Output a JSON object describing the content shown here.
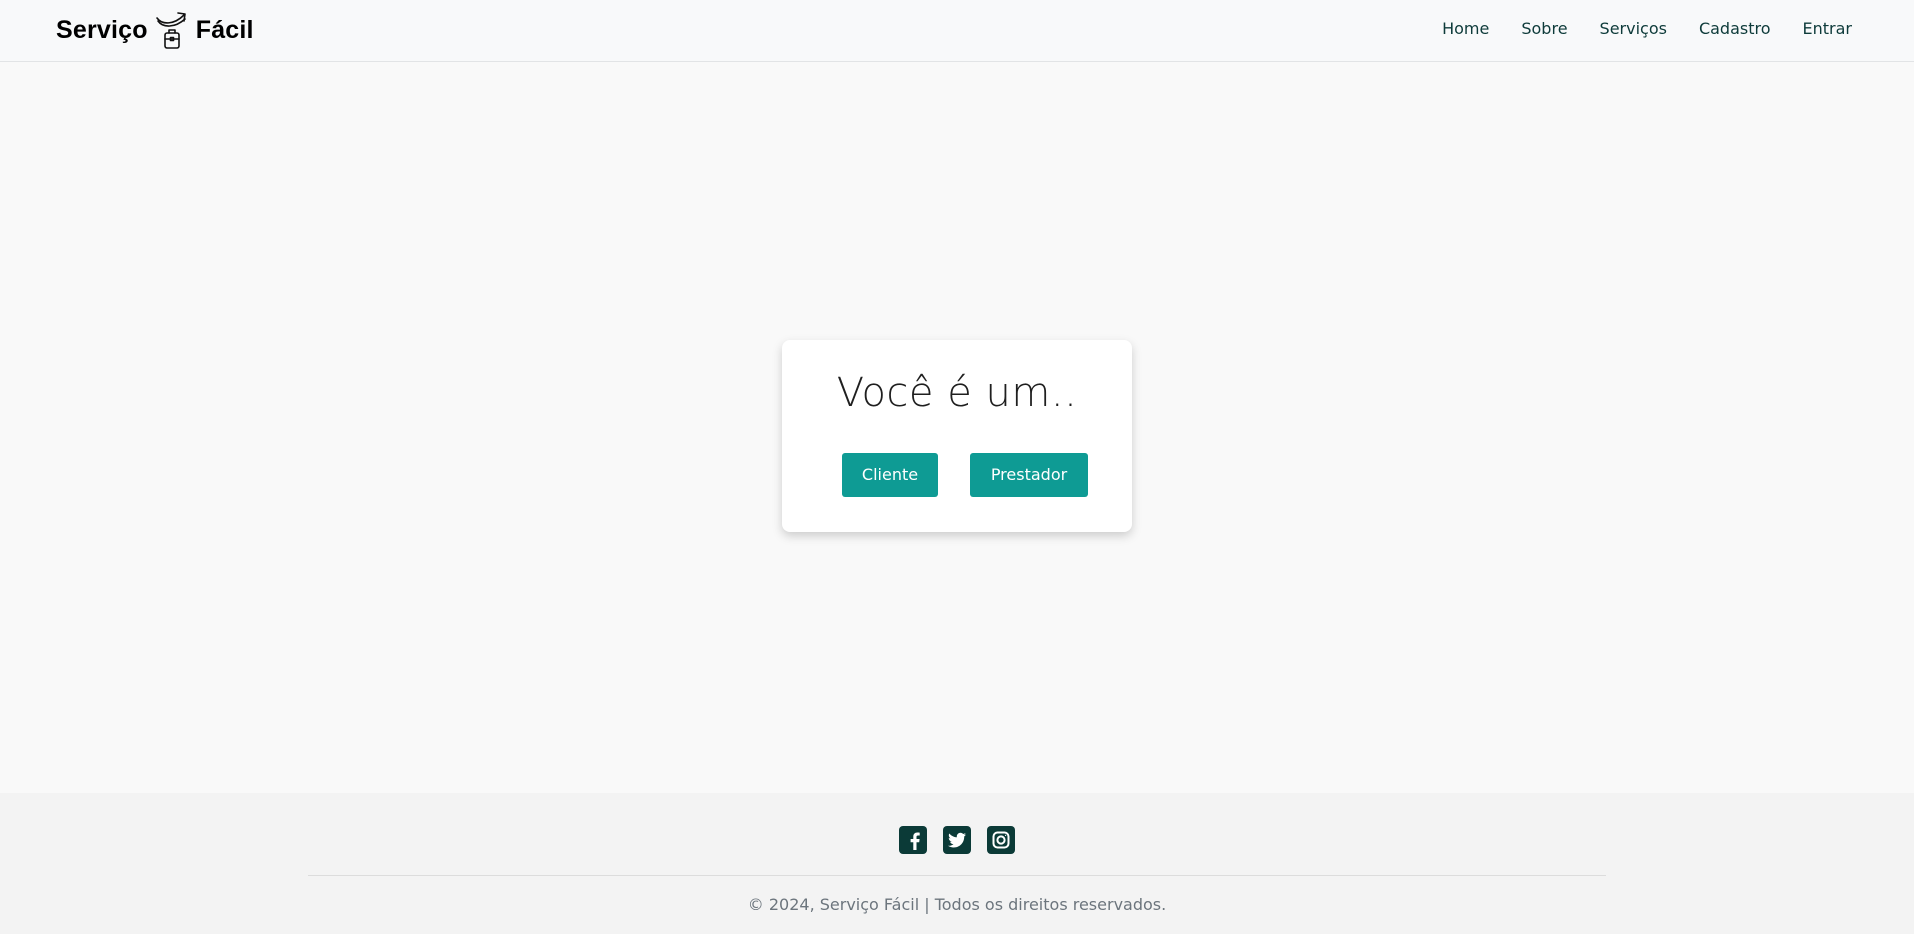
{
  "header": {
    "brand_left": "Serviço",
    "brand_right": "Fácil",
    "brand_logo_icon": "briefcase-arrow-icon",
    "nav": [
      {
        "label": "Home"
      },
      {
        "label": "Sobre"
      },
      {
        "label": "Serviços"
      },
      {
        "label": "Cadastro"
      },
      {
        "label": "Entrar"
      }
    ]
  },
  "main": {
    "title": "Você é um..",
    "buttons": {
      "client_label": "Cliente",
      "provider_label": "Prestador"
    }
  },
  "footer": {
    "social_icons": [
      "facebook-icon",
      "twitter-icon",
      "instagram-icon"
    ],
    "copyright": "© 2024, Serviço Fácil | Todos os direitos reservados."
  },
  "colors": {
    "accent": "#0e9b94",
    "nav_text": "#0e3b3a",
    "social_bg": "#0b3a37",
    "page_bg": "#f9f9f9",
    "footer_bg": "#f3f3f3"
  }
}
